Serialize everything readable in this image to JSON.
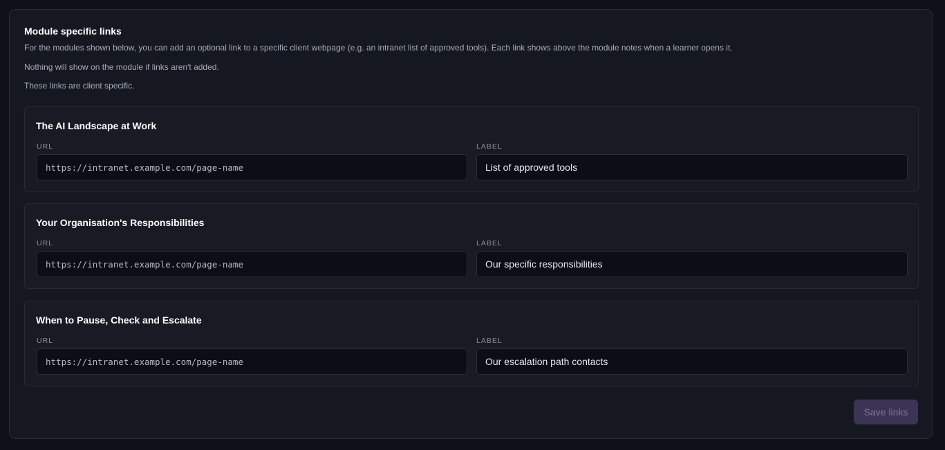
{
  "section": {
    "title": "Module specific links",
    "descriptions": [
      "For the modules shown below, you can add an optional link to a specific client webpage (e.g. an intranet list of approved tools). Each link shows above the module notes when a learner opens it.",
      "Nothing will show on the module if links aren't added.",
      "These links are client specific."
    ]
  },
  "fields": {
    "url_label": "URL",
    "label_label": "LABEL"
  },
  "modules": [
    {
      "title": "The AI Landscape at Work",
      "url_value": "",
      "url_placeholder": "https://intranet.example.com/page-name",
      "label_value": "List of approved tools"
    },
    {
      "title": "Your Organisation's Responsibilities",
      "url_value": "",
      "url_placeholder": "https://intranet.example.com/page-name",
      "label_value": "Our specific responsibilities"
    },
    {
      "title": "When to Pause, Check and Escalate",
      "url_value": "",
      "url_placeholder": "https://intranet.example.com/page-name",
      "label_value": "Our escalation path contacts"
    }
  ],
  "actions": {
    "save_label": "Save links"
  },
  "colors": {
    "background": "#0f1118",
    "panel": "#151820",
    "card": "#181b23",
    "input": "#0c0e15",
    "accent_disabled": "#3b3454"
  }
}
